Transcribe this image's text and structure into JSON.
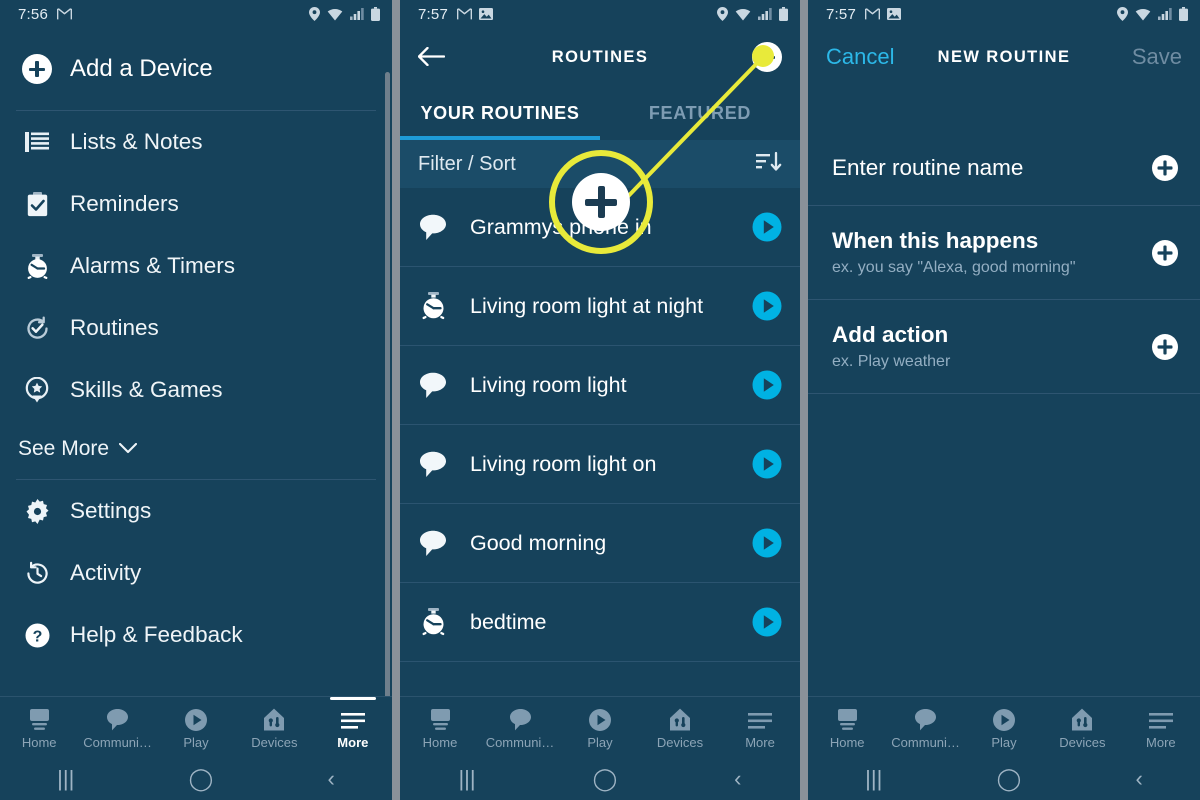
{
  "theme": {
    "bg": "#16425b",
    "accent_cyan": "#00b2e3",
    "tab_underline": "#1e9bd7",
    "highlight_yellow": "#e8ea3a",
    "separator_gray": "#8a9199",
    "muted_text": "#8ca4b6"
  },
  "left_panel": {
    "statusbar": {
      "time": "7:56",
      "left_icons": [
        "gmail-icon"
      ],
      "right_icons": [
        "location-pin-icon",
        "wifi-icon",
        "signal-bars-icon",
        "battery-icon"
      ]
    },
    "add_device": {
      "label": "Add a Device",
      "icon": "plus-circle-icon"
    },
    "menu_items": [
      {
        "label": "Lists & Notes",
        "icon": "list-lines-icon"
      },
      {
        "label": "Reminders",
        "icon": "clipboard-check-icon"
      },
      {
        "label": "Alarms & Timers",
        "icon": "alarm-clock-icon"
      },
      {
        "label": "Routines",
        "icon": "refresh-check-icon"
      },
      {
        "label": "Skills & Games",
        "icon": "location-star-icon"
      }
    ],
    "see_more": {
      "label": "See More",
      "icon": "chevron-down-icon"
    },
    "menu_items_2": [
      {
        "label": "Settings",
        "icon": "gear-icon"
      },
      {
        "label": "Activity",
        "icon": "clock-history-icon"
      },
      {
        "label": "Help & Feedback",
        "icon": "question-circle-icon"
      }
    ],
    "bottom_nav": [
      {
        "label": "Home",
        "icon": "home-icon",
        "active": false
      },
      {
        "label": "Communi…",
        "icon": "chat-bubble-icon",
        "active": false
      },
      {
        "label": "Play",
        "icon": "play-circle-icon",
        "active": false
      },
      {
        "label": "Devices",
        "icon": "devices-house-icon",
        "active": false
      },
      {
        "label": "More",
        "icon": "hamburger-icon",
        "active": true
      }
    ],
    "sysnav": [
      "recents-icon",
      "home-circle-icon",
      "back-chevron-icon"
    ]
  },
  "middle_panel": {
    "statusbar": {
      "time": "7:57",
      "left_icons": [
        "gmail-icon",
        "image-icon"
      ],
      "right_icons": [
        "location-pin-icon",
        "wifi-icon",
        "signal-bars-icon",
        "battery-icon"
      ]
    },
    "appbar": {
      "back_icon": "arrow-left-icon",
      "title": "ROUTINES",
      "add_icon": "plus-circle-icon"
    },
    "tabs": [
      {
        "label": "YOUR ROUTINES",
        "active": true
      },
      {
        "label": "FEATURED",
        "active": false
      }
    ],
    "filter_sort": {
      "label": "Filter / Sort",
      "icon": "sort-descending-icon"
    },
    "routines": [
      {
        "name": "Grammys phone in",
        "icon": "chat-bubble-icon",
        "play_icon": "play-circle-icon"
      },
      {
        "name": "Living room light at night",
        "icon": "alarm-clock-icon",
        "play_icon": "play-circle-icon"
      },
      {
        "name": "Living room light",
        "icon": "chat-bubble-icon",
        "play_icon": "play-circle-icon"
      },
      {
        "name": "Living room light on",
        "icon": "chat-bubble-icon",
        "play_icon": "play-circle-icon"
      },
      {
        "name": "Good morning",
        "icon": "chat-bubble-icon",
        "play_icon": "play-circle-icon"
      },
      {
        "name": "bedtime",
        "icon": "alarm-clock-icon",
        "play_icon": "play-circle-icon"
      }
    ],
    "callout": {
      "magnified_icon": "plus-circle-icon",
      "points_to": "add-routine-button"
    },
    "bottom_nav": [
      {
        "label": "Home",
        "icon": "home-icon",
        "active": false
      },
      {
        "label": "Communi…",
        "icon": "chat-bubble-icon",
        "active": false
      },
      {
        "label": "Play",
        "icon": "play-circle-icon",
        "active": false
      },
      {
        "label": "Devices",
        "icon": "devices-house-icon",
        "active": false
      },
      {
        "label": "More",
        "icon": "hamburger-icon",
        "active": false
      }
    ],
    "sysnav": [
      "recents-icon",
      "home-circle-icon",
      "back-chevron-icon"
    ]
  },
  "right_panel": {
    "statusbar": {
      "time": "7:57",
      "left_icons": [
        "gmail-icon",
        "image-icon"
      ],
      "right_icons": [
        "location-pin-icon",
        "wifi-icon",
        "signal-bars-icon",
        "battery-icon"
      ]
    },
    "appbar": {
      "cancel_label": "Cancel",
      "title": "NEW ROUTINE",
      "save_label": "Save"
    },
    "form_rows": [
      {
        "title": "Enter routine name",
        "subtitle": "",
        "plus_icon": "plus-circle-icon",
        "bold": false
      },
      {
        "title": "When this happens",
        "subtitle": "ex. you say \"Alexa, good morning\"",
        "plus_icon": "plus-circle-icon",
        "bold": true
      },
      {
        "title": "Add action",
        "subtitle": "ex. Play weather",
        "plus_icon": "plus-circle-icon",
        "bold": true
      }
    ],
    "bottom_nav": [
      {
        "label": "Home",
        "icon": "home-icon",
        "active": false
      },
      {
        "label": "Communi…",
        "icon": "chat-bubble-icon",
        "active": false
      },
      {
        "label": "Play",
        "icon": "play-circle-icon",
        "active": false
      },
      {
        "label": "Devices",
        "icon": "devices-house-icon",
        "active": false
      },
      {
        "label": "More",
        "icon": "hamburger-icon",
        "active": false
      }
    ],
    "sysnav": [
      "recents-icon",
      "home-circle-icon",
      "back-chevron-icon"
    ]
  }
}
